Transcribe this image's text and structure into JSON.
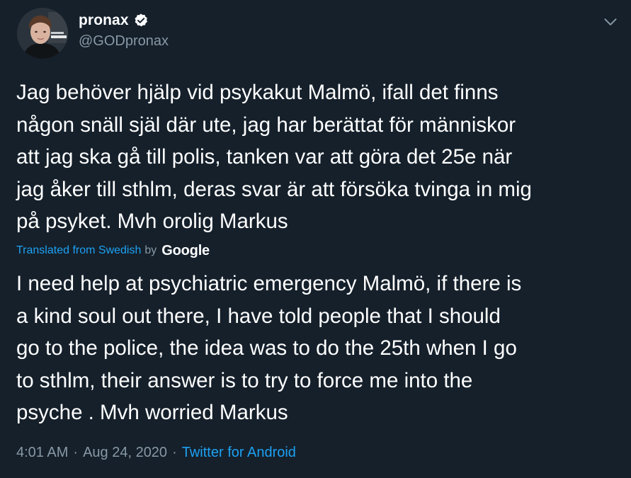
{
  "user": {
    "display_name": "pronax",
    "handle": "@GODpronax",
    "verified": true,
    "avatar_icon": "profile-photo-icon",
    "verified_icon": "verified-badge-icon"
  },
  "menu": {
    "icon": "chevron-down-icon"
  },
  "tweet": {
    "original_lines": [
      "Jag behöver hjälp vid psykakut Malmö, ifall det finns",
      "någon snäll själ där ute, jag har berättat för människor",
      "att jag ska gå till polis, tanken var att göra det 25e när",
      "jag åker till sthlm, deras svar är att försöka tvinga in mig",
      "på psyket. Mvh orolig Markus"
    ],
    "translation_notice": "Translated from Swedish",
    "translation_by": "by",
    "translation_provider": "Google",
    "translated_lines": [
      "I need help at psychiatric emergency Malmö, if there is",
      "a kind soul out there, I have told people that I should",
      "go to the police, the idea was to do the 25th when I go",
      "to sthlm, their answer is to try to force me into the",
      "psyche . Mvh worried Markus"
    ]
  },
  "meta": {
    "time": "4:01 AM",
    "separator": "·",
    "date": "Aug 24, 2020",
    "source": "Twitter for Android"
  },
  "colors": {
    "background": "#15202b",
    "text": "#ffffff",
    "secondary": "#8899a6",
    "link": "#1da1f2"
  }
}
